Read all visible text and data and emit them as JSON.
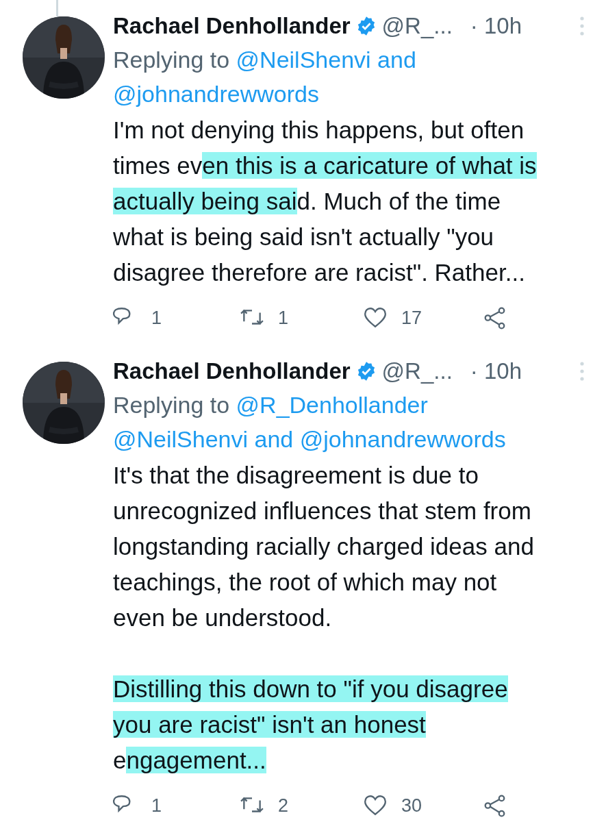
{
  "tweets": [
    {
      "connected_above": true,
      "author": {
        "name": "Rachael Denhollander",
        "verified": true,
        "handle": "@R_...",
        "time": "· 10h"
      },
      "reply_to": [
        [
          {
            "kind": "label",
            "text": "Replying to"
          },
          {
            "kind": "mention",
            "text": "@NeilShenvi"
          },
          {
            "kind": "conjunction",
            "text": "and"
          }
        ],
        [
          {
            "kind": "mention",
            "text": "@johnandrewwords"
          }
        ]
      ],
      "paragraphs": [
        [
          {
            "text": "I'm not denying this happens, but often\ntimes ev",
            "highlighted": false
          },
          {
            "text": "en this is a caricature of what is\nactually being sai",
            "highlighted": true
          },
          {
            "text": "d. Much of the time\nwhat is being said isn't actually \"you\ndisagree therefore are racist\". Rather...",
            "highlighted": false
          }
        ]
      ],
      "actions": [
        {
          "kind": "reply",
          "count": "1"
        },
        {
          "kind": "retweet",
          "count": "1"
        },
        {
          "kind": "like",
          "count": "17"
        },
        {
          "kind": "share"
        }
      ]
    },
    {
      "connected_above": false,
      "author": {
        "name": "Rachael Denhollander",
        "verified": true,
        "handle": "@R_...",
        "time": "· 10h"
      },
      "reply_to": [
        [
          {
            "kind": "label",
            "text": "Replying to"
          },
          {
            "kind": "mention",
            "text": "@R_Denhollander"
          }
        ],
        [
          {
            "kind": "mention",
            "text": "@NeilShenvi"
          },
          {
            "kind": "conjunction",
            "text": "and"
          },
          {
            "kind": "mention",
            "text": "@johnandrewwords"
          }
        ]
      ],
      "paragraphs": [
        [
          {
            "text": "It's that the disagreement is due to\nunrecognized influences that stem from\nlongstanding racially charged ideas and\nteachings, the root of which may not\neven be understood.",
            "highlighted": false
          }
        ],
        [
          {
            "text": "Distilling this down to \"if you disagree\nyou are racist\" isn't an honest\n",
            "highlighted": true
          },
          {
            "text": "e",
            "highlighted": false
          },
          {
            "text": "ngagement...",
            "highlighted": true
          }
        ]
      ],
      "actions": [
        {
          "kind": "reply",
          "count": "1"
        },
        {
          "kind": "retweet",
          "count": "2"
        },
        {
          "kind": "like",
          "count": "30"
        },
        {
          "kind": "share"
        }
      ]
    }
  ]
}
